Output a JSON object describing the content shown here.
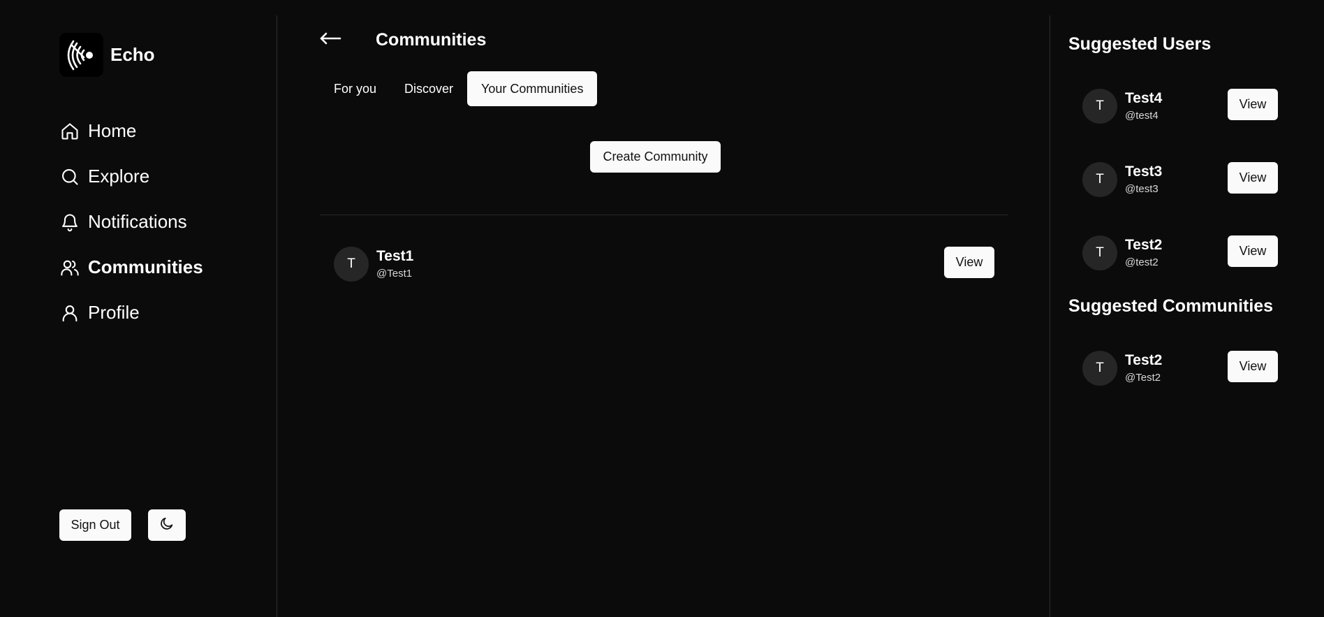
{
  "brand": {
    "name": "Echo"
  },
  "nav": [
    {
      "label": "Home",
      "icon": "home-icon"
    },
    {
      "label": "Explore",
      "icon": "search-icon"
    },
    {
      "label": "Notifications",
      "icon": "bell-icon"
    },
    {
      "label": "Communities",
      "icon": "users-icon",
      "active": true
    },
    {
      "label": "Profile",
      "icon": "user-icon"
    }
  ],
  "sidebar": {
    "sign_out_label": "Sign Out",
    "theme_icon": "moon-icon"
  },
  "header": {
    "title": "Communities",
    "back_icon": "arrow-left-icon"
  },
  "tabs": [
    {
      "label": "For you"
    },
    {
      "label": "Discover"
    },
    {
      "label": "Your Communities",
      "active": true
    }
  ],
  "main": {
    "create_label": "Create Community",
    "communities": [
      {
        "initial": "T",
        "name": "Test1",
        "handle": "@Test1",
        "action": "View"
      }
    ]
  },
  "right": {
    "suggested_users_title": "Suggested Users",
    "suggested_users": [
      {
        "initial": "T",
        "name": "Test4",
        "handle": "@test4",
        "action": "View"
      },
      {
        "initial": "T",
        "name": "Test3",
        "handle": "@test3",
        "action": "View"
      },
      {
        "initial": "T",
        "name": "Test2",
        "handle": "@test2",
        "action": "View"
      }
    ],
    "suggested_communities_title": "Suggested Communities",
    "suggested_communities": [
      {
        "initial": "T",
        "name": "Test2",
        "handle": "@Test2",
        "action": "View"
      }
    ]
  },
  "colors": {
    "background": "#0b0b0b",
    "button": "#fafafa",
    "avatar": "#262626",
    "divider": "#2e2e2e"
  }
}
